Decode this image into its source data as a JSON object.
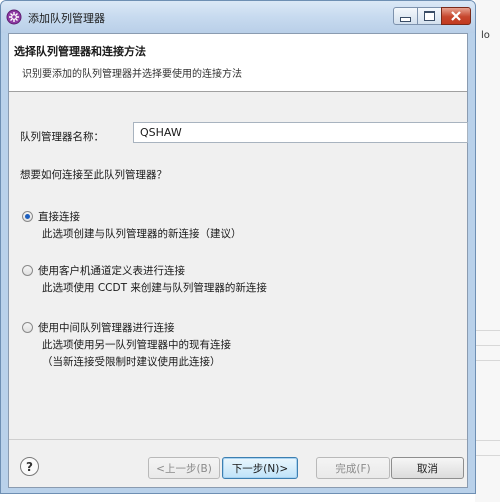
{
  "window": {
    "title": "添加队列管理器",
    "background_fragment": "lo"
  },
  "header": {
    "title": "选择队列管理器和连接方法",
    "description": "识别要添加的队列管理器并选择要使用的连接方法"
  },
  "form": {
    "name_label": "队列管理器名称：",
    "name_value": "QSHAW",
    "question": "想要如何连接至此队列管理器？"
  },
  "options": [
    {
      "label": "直接连接",
      "selected": true,
      "description": [
        "此选项创建与队列管理器的新连接（建议）"
      ]
    },
    {
      "label": "使用客户机通道定义表进行连接",
      "selected": false,
      "description": [
        "此选项使用 CCDT 来创建与队列管理器的新连接"
      ]
    },
    {
      "label": "使用中间队列管理器进行连接",
      "selected": false,
      "description": [
        "此选项使用另一队列管理器中的现有连接",
        "（当新连接受限制时建议使用此连接）"
      ]
    }
  ],
  "buttons": {
    "help": "?",
    "back": "<上一步(B)",
    "next": "下一步(N)>",
    "finish": "完成(F)",
    "cancel": "取消"
  },
  "colors": {
    "selected_radio": "#1d5fbf",
    "title_bar": "#c7daef",
    "close_button": "#c6462d"
  },
  "icons": {
    "app": "ibm-mq-icon",
    "minimize": "minimize-icon",
    "maximize": "maximize-icon",
    "close": "close-icon",
    "help": "help-icon"
  }
}
